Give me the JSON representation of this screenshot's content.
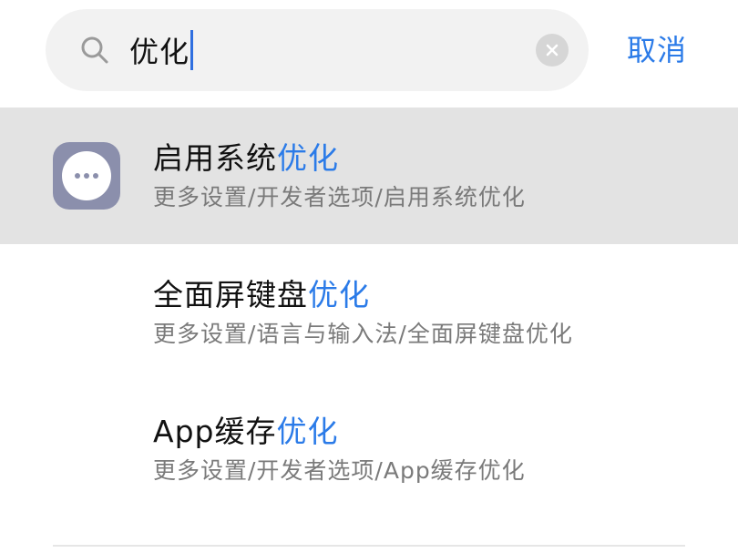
{
  "search": {
    "query": "优化",
    "cancel_label": "取消"
  },
  "results": [
    {
      "title_prefix": "启用系统",
      "title_match": "优化",
      "path": "更多设置/开发者选项/启用系统优化",
      "icon": "more-options-icon",
      "highlighted": true
    },
    {
      "title_prefix": "全面屏键盘",
      "title_match": "优化",
      "path": "更多设置/语言与输入法/全面屏键盘优化",
      "highlighted": false
    },
    {
      "title_prefix": "App缓存",
      "title_match": "优化",
      "path": "更多设置/开发者选项/App缓存优化",
      "highlighted": false
    }
  ],
  "colors": {
    "accent": "#2b7be8",
    "highlight_row": "#e3e3e3",
    "search_bg": "#f2f2f2",
    "icon_bg": "#8b8fac"
  }
}
